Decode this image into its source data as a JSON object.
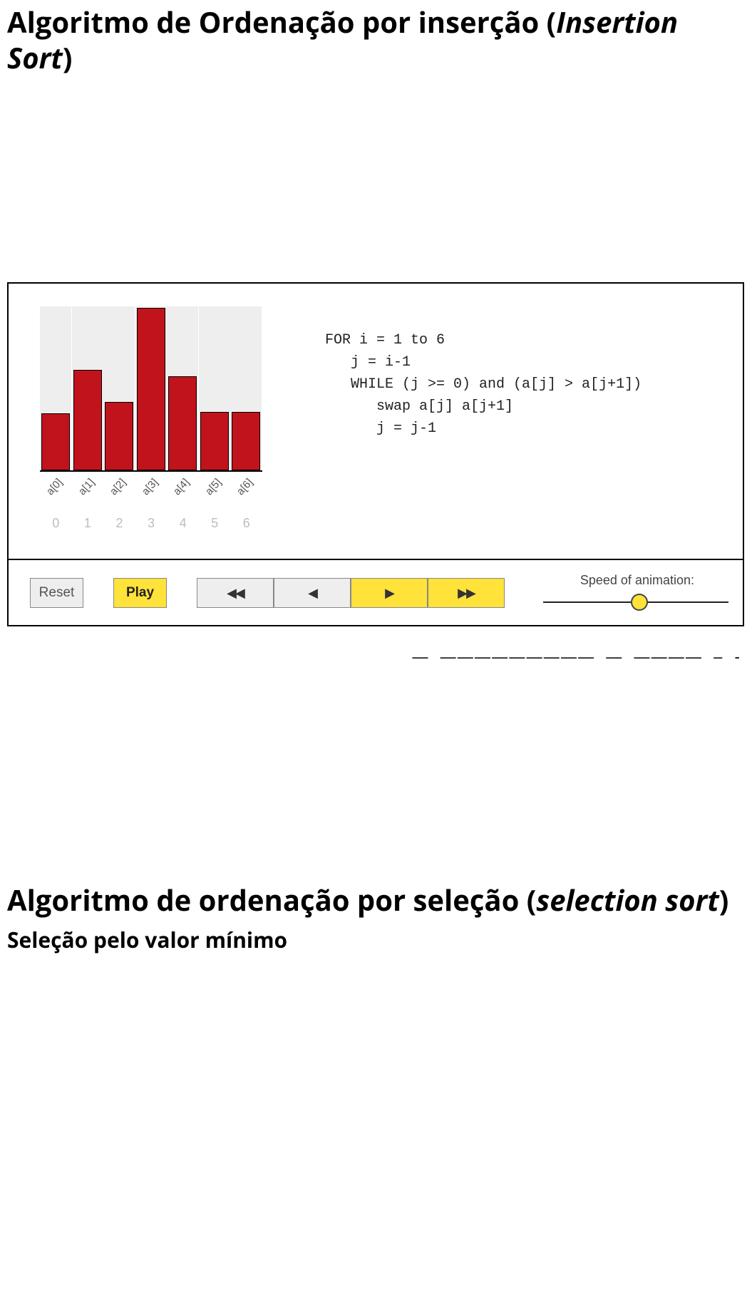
{
  "heading1": {
    "prefix": "Algoritmo de Ordenação por inserção (",
    "italic": "Insertion Sort",
    "suffix": ")"
  },
  "chart_data": {
    "type": "bar",
    "categories": [
      "a[0]",
      "a[1]",
      "a[2]",
      "a[3]",
      "a[4]",
      "a[5]",
      "a[6]"
    ],
    "indexes": [
      "0",
      "1",
      "2",
      "3",
      "4",
      "5",
      "6"
    ],
    "values": [
      35,
      62,
      42,
      100,
      58,
      36,
      36
    ],
    "title": "",
    "xlabel": "",
    "ylabel": "",
    "ylim": [
      0,
      100
    ]
  },
  "code": {
    "lines": [
      "FOR i = 1 to 6",
      "   j = i-1",
      "   WHILE (j >= 0) and (a[j] > a[j+1])",
      "      swap a[j] a[j+1]",
      "      j = j-1"
    ]
  },
  "controls": {
    "reset": "Reset",
    "play": "Play",
    "speed_label": "Speed of animation:",
    "slider_percent": 52
  },
  "credit_line": "— —————————  —   ———— – -",
  "heading2": {
    "prefix": "Algoritmo de ordenação por seleção (",
    "italic": "selection sort",
    "suffix": ")"
  },
  "subheading2": "Seleção pelo valor mínimo"
}
